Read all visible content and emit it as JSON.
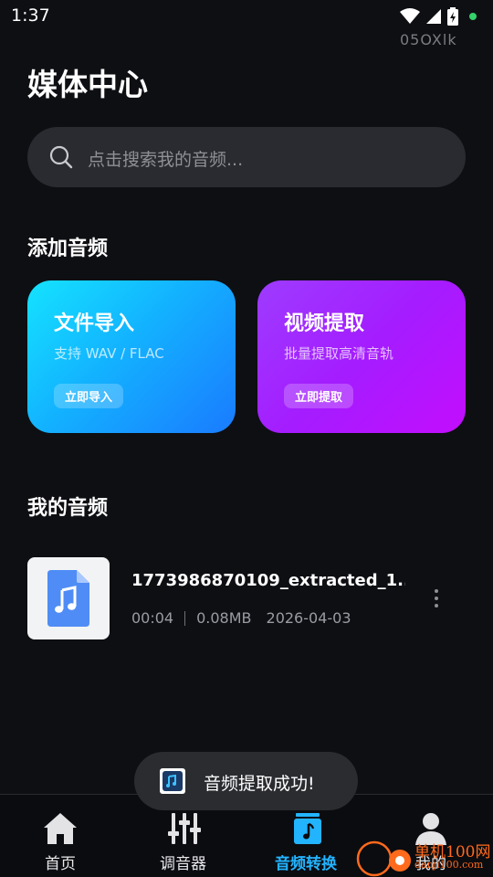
{
  "status_bar": {
    "time": "1:37",
    "sub_text": "05OXlk"
  },
  "header": {
    "title": "媒体中心"
  },
  "search": {
    "placeholder": "点击搜索我的音频..."
  },
  "add_section": {
    "title": "添加音频",
    "cards": [
      {
        "title": "文件导入",
        "subtitle": "支持 WAV / FLAC",
        "button": "立即导入"
      },
      {
        "title": "视频提取",
        "subtitle": "批量提取高清音轨",
        "button": "立即提取"
      }
    ]
  },
  "my_audio": {
    "title": "我的音频",
    "items": [
      {
        "name": "1773986870109_extracted_1...",
        "duration": "00:04",
        "size": "0.08MB",
        "date": "2026-04-03"
      }
    ]
  },
  "toast": {
    "text": "音频提取成功!"
  },
  "bottom_nav": {
    "items": [
      {
        "label": "首页",
        "icon": "home-icon",
        "active": false
      },
      {
        "label": "调音器",
        "icon": "equalizer-icon",
        "active": false
      },
      {
        "label": "音频转换",
        "icon": "audio-convert-icon",
        "active": true
      },
      {
        "label": "我的",
        "icon": "profile-icon",
        "active": false
      }
    ]
  },
  "watermark": {
    "line1": "单机100网",
    "line2": "danji100.com"
  },
  "colors": {
    "background": "#0e0f13",
    "accent": "#23b4ff",
    "import_card": "#13b2ff",
    "extract_card": "#a41cff"
  }
}
